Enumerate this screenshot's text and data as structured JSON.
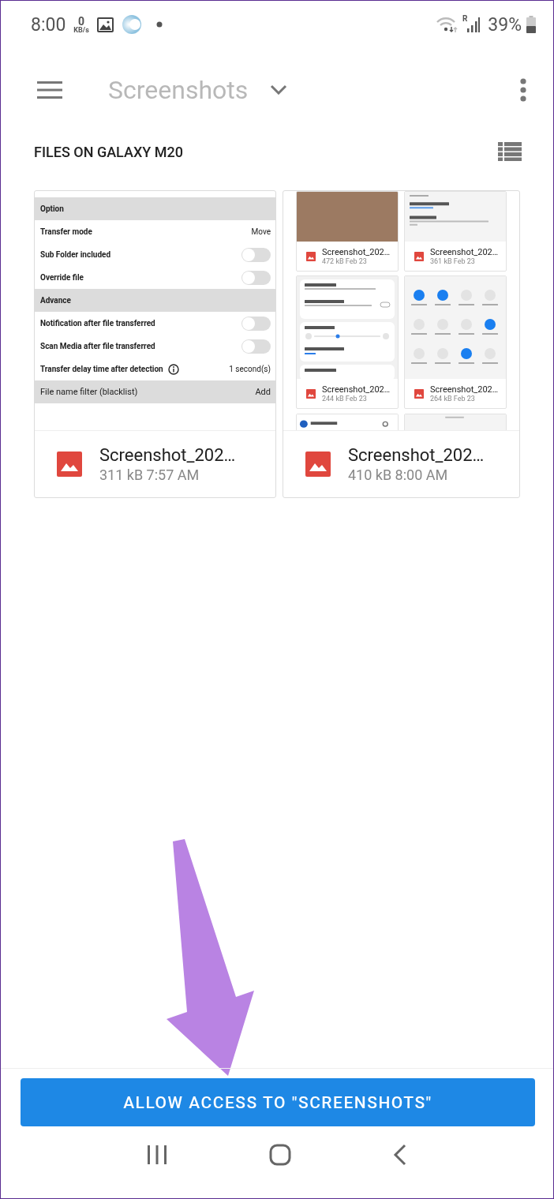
{
  "status_bar": {
    "time": "8:00",
    "speed_value": "0",
    "speed_unit": "KB/s",
    "network_label": "R",
    "battery": "39%"
  },
  "toolbar": {
    "title": "Screenshots"
  },
  "section": {
    "title": "FILES ON GALAXY M20"
  },
  "files": [
    {
      "kind": "settings",
      "name": "Screenshot_202…",
      "meta": "311 kB 7:57 AM",
      "rows": [
        {
          "kind": "header",
          "label": "Option"
        },
        {
          "kind": "value",
          "label": "Transfer mode",
          "value": "Move"
        },
        {
          "kind": "toggle",
          "label": "Sub Folder included",
          "on": false
        },
        {
          "kind": "toggle",
          "label": "Override file",
          "on": false
        },
        {
          "kind": "header",
          "label": "Advance"
        },
        {
          "kind": "toggle",
          "label": "Notification after file transferred",
          "on": false
        },
        {
          "kind": "toggle",
          "label": "Scan Media after file transferred",
          "on": false
        },
        {
          "kind": "info",
          "label": "Transfer delay time after detection",
          "value": "1 second(s)"
        },
        {
          "kind": "filter",
          "label": "File name filter (blacklist)",
          "value": "Add"
        }
      ]
    },
    {
      "kind": "grid",
      "name": "Screenshot_202…",
      "meta": "410 kB 8:00 AM",
      "items": [
        {
          "name": "Screenshot_202…",
          "meta": "472 kB Feb 23"
        },
        {
          "kind": "touch",
          "name": "Screenshot_202…",
          "meta": "361 kB Feb 23"
        },
        {
          "kind": "assistant",
          "name": "Screenshot_202…",
          "meta": "244 kB Feb 23"
        },
        {
          "kind": "quick",
          "name": "Screenshot_202…",
          "meta": "264 kB Feb 23"
        },
        {
          "kind": "app"
        },
        {
          "kind": "store"
        }
      ]
    }
  ],
  "action_button": {
    "label": "ALLOW ACCESS TO \"SCREENSHOTS\""
  }
}
